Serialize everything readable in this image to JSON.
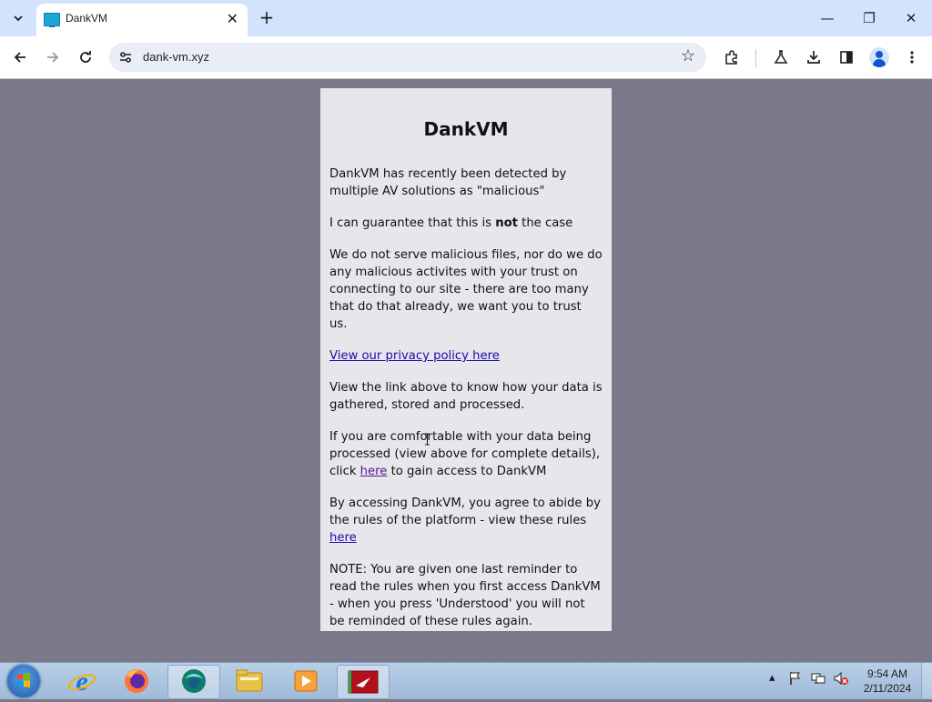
{
  "browser": {
    "tab": {
      "title": "DankVM",
      "close": "✕"
    },
    "new_tab": "+",
    "tab_search": "⌄",
    "window": {
      "minimize": "—",
      "restore": "❐",
      "close": "✕"
    },
    "nav": {
      "back": "←",
      "forward": "→",
      "reload": "↻"
    },
    "address": "dank-vm.xyz",
    "icons": [
      "site-settings-icon",
      "bookmark-star-icon",
      "extensions-icon",
      "labs-icon",
      "downloads-icon",
      "side-panel-icon",
      "profile-icon",
      "menu-icon"
    ]
  },
  "page": {
    "title": "DankVM",
    "p1": "DankVM has recently been detected by multiple AV solutions as \"malicious\"",
    "p2_before": "I can guarantee that this is ",
    "p2_bold": "not",
    "p2_after": " the case",
    "p3": "We do not serve malicious files, nor do we do any malicious activites with your trust on connecting to our site - there are too many that do that already, we want you to trust us.",
    "privacy_link": "View our privacy policy here",
    "p4": "View the link above to know how your data is gathered, stored and processed.",
    "p5_before": "If you are comfortable with your data being processed (view above for complete details), click ",
    "p5_link": "here",
    "p5_after": " to gain access to DankVM",
    "p6_before": "By accessing DankVM, you agree to abide by the rules of the platform - view these rules ",
    "p6_link": "here",
    "p7": "NOTE: You are given one last reminder to read the rules when you first access DankVM - when you press 'Understood' you will not be reminded of these rules again."
  },
  "colors": {
    "page_bg": "#7a7889",
    "card_bg": "#e7e6ea",
    "link": "#1a0dab",
    "visited_link": "#551a8b"
  },
  "taskbar": {
    "apps": [
      "internet-explorer-icon",
      "firefox-icon",
      "vm-client-icon",
      "file-explorer-icon",
      "media-player-icon",
      "vm-app-icon"
    ],
    "clock_time": "9:54 AM",
    "clock_date": "2/11/2024"
  }
}
